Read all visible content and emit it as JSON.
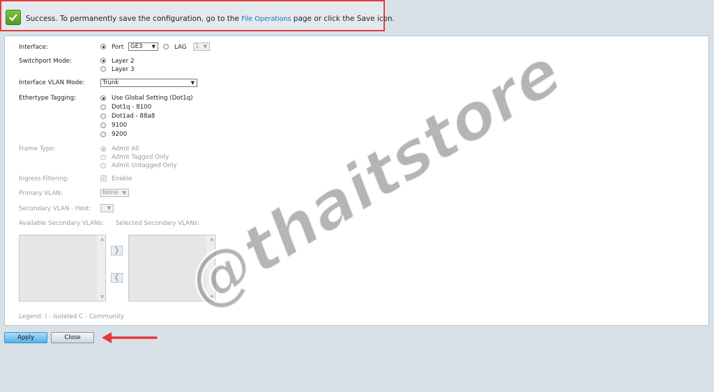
{
  "banner": {
    "text_before": "Success. To permanently save the configuration, go to the ",
    "link": "File Operations",
    "text_after": " page or click the Save icon."
  },
  "form": {
    "interface": {
      "label": "Interface:",
      "port_label": "Port",
      "port_value": "GE3",
      "lag_label": "LAG",
      "lag_value": "1"
    },
    "switchport_mode": {
      "label": "Switchport Mode:",
      "options": [
        "Layer 2",
        "Layer 3"
      ],
      "selected": "Layer 2"
    },
    "vlan_mode": {
      "label": "Interface VLAN Mode:",
      "value": "Trunk"
    },
    "ethertype": {
      "label": "Ethertype Tagging:",
      "options": [
        "Use Global Setting (Dot1q)",
        "Dot1q - 8100",
        "Dot1ad - 88a8",
        "9100",
        "9200"
      ],
      "selected": "Use Global Setting (Dot1q)"
    },
    "frame_type": {
      "label": "Frame Type:",
      "options": [
        "Admit All",
        "Admit Tagged Only",
        "Admit Untagged Only"
      ],
      "selected": "Admit All"
    },
    "ingress": {
      "label": "Ingress Filtering:",
      "option": "Enable",
      "checked": true
    },
    "primary_vlan": {
      "label": "Primary VLAN:",
      "value": "None"
    },
    "secondary_host": {
      "label": "Secondary VLAN - Host:"
    },
    "available_label": "Available Secondary VLANs:",
    "selected_label": "Selected Secondary VLANs:",
    "legend": "Legend: I - Isolated C - Community"
  },
  "buttons": {
    "apply": "Apply",
    "close": "Close"
  },
  "watermark": "@thaitstore",
  "colors": {
    "highlight": "#e53b3b",
    "apply": "#54b3ec",
    "link": "#1f6fb2"
  },
  "icons": {
    "success": "check-icon",
    "move_right": "chevron-right-icon",
    "move_left": "chevron-left-icon"
  }
}
